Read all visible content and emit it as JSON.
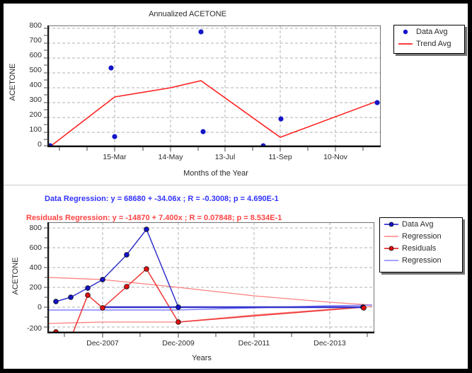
{
  "top_chart": {
    "title": "Annualized ACETONE",
    "xlabel": "Months of the Year",
    "ylabel": "ACETONE",
    "legend": [
      {
        "label": "Data Avg",
        "marker": "dot",
        "color": "#1414c8"
      },
      {
        "label": "Trend Avg",
        "marker": "line",
        "color": "#ff2222"
      }
    ],
    "yticks": [
      "0",
      "100",
      "200",
      "300",
      "400",
      "500",
      "600",
      "700",
      "800"
    ],
    "xticks": [
      "15-Mar",
      "14-May",
      "13-Jul",
      "11-Sep",
      "10-Nov"
    ]
  },
  "bottom_chart": {
    "xlabel": "Years",
    "ylabel": "ACETONE",
    "data_regression": "Data Regression: y = 68680 + -34.06x ; R = -0.3008; p = 4.690E-1",
    "residuals_regression": "Residuals Regression: y = -14870 + 7.400x ; R = 0.07848; p = 8.534E-1",
    "legend": [
      {
        "label": "Data Avg",
        "marker": "line-dot",
        "color": "#1414c8"
      },
      {
        "label": "Regression",
        "marker": "line",
        "color": "#ff8080"
      },
      {
        "label": "Residuals",
        "marker": "line-dot",
        "color": "#e01010"
      },
      {
        "label": "Regression",
        "marker": "line",
        "color": "#8080ff"
      }
    ],
    "yticks": [
      "-200",
      "0",
      "200",
      "400",
      "600",
      "800"
    ],
    "xticks": [
      "Dec-2007",
      "Dec-2009",
      "Dec-2011",
      "Dec-2013"
    ]
  },
  "colors": {
    "data_blue": "#1414c8",
    "trend_red": "#ff2222",
    "residual_red": "#e01010",
    "regression_light_red": "#ff8080",
    "regression_light_blue": "#8080ff",
    "border": "#000000",
    "grid": "#b0b0b0",
    "text": "#2b2b2b"
  },
  "chart_data": [
    {
      "type": "scatter",
      "id": "annualized-acetone",
      "title": "Annualized ACETONE",
      "xlabel": "Months of the Year",
      "ylabel": "ACETONE",
      "ylim": [
        0,
        860
      ],
      "xlim": [
        0,
        365
      ],
      "grid": true,
      "legend_position": "right-outside",
      "xtick_labels": [
        "15-Mar",
        "14-May",
        "13-Jul",
        "11-Sep",
        "10-Nov"
      ],
      "xtick_days": [
        74,
        135,
        195,
        255,
        315
      ],
      "ytick_values": [
        0,
        100,
        200,
        300,
        400,
        500,
        600,
        700,
        800
      ],
      "series": [
        {
          "name": "Data Avg",
          "type": "scatter",
          "color": "#1414c8",
          "points": [
            {
              "x": 3,
              "y": 8
            },
            {
              "x": 70,
              "y": 520
            },
            {
              "x": 74,
              "y": 72
            },
            {
              "x": 168,
              "y": 840
            },
            {
              "x": 170,
              "y": 106
            },
            {
              "x": 236,
              "y": 8
            },
            {
              "x": 256,
              "y": 188
            },
            {
              "x": 360,
              "y": 298
            }
          ]
        },
        {
          "name": "Trend Avg",
          "type": "line",
          "color": "#ff2222",
          "points": [
            {
              "x": 3,
              "y": 4
            },
            {
              "x": 74,
              "y": 330
            },
            {
              "x": 135,
              "y": 392
            },
            {
              "x": 168,
              "y": 440
            },
            {
              "x": 256,
              "y": 68
            },
            {
              "x": 360,
              "y": 300
            }
          ]
        }
      ]
    },
    {
      "type": "line",
      "id": "acetone-residuals-over-years",
      "xlabel": "Years",
      "ylabel": "ACETONE",
      "ylim": [
        -330,
        880
      ],
      "xlim": [
        2006.4,
        2015.0
      ],
      "grid": true,
      "legend_position": "right-outside",
      "xtick_labels": [
        "Dec-2007",
        "Dec-2009",
        "Dec-2011",
        "Dec-2013"
      ],
      "xtick_values": [
        2007.95,
        2009.95,
        2011.95,
        2013.95
      ],
      "ytick_values": [
        -200,
        0,
        200,
        400,
        600,
        800
      ],
      "annotations": [
        "Data Regression: y = 68680 + -34.06x ; R = -0.3008; p = 4.690E-1",
        "Residuals Regression: y = -14870 + 7.400x ; R = 0.07848; p = 8.534E-1"
      ],
      "series": [
        {
          "name": "Data Avg",
          "type": "line-marker",
          "color": "#1414c8",
          "points": [
            {
              "x": 2006.75,
              "y": 62
            },
            {
              "x": 2007.2,
              "y": 108
            },
            {
              "x": 2007.62,
              "y": 192
            },
            {
              "x": 2007.95,
              "y": 282
            },
            {
              "x": 2008.42,
              "y": 530
            },
            {
              "x": 2008.85,
              "y": 840
            },
            {
              "x": 2009.95,
              "y": 8
            },
            {
              "x": 2014.72,
              "y": 8
            }
          ]
        },
        {
          "name": "Residuals",
          "type": "line-marker",
          "color": "#e01010",
          "points": [
            {
              "x": 2006.75,
              "y": -252
            },
            {
              "x": 2007.2,
              "y": -312
            },
            {
              "x": 2007.62,
              "y": 118
            },
            {
              "x": 2007.95,
              "y": -8
            },
            {
              "x": 2008.42,
              "y": 208
            },
            {
              "x": 2008.85,
              "y": 388
            },
            {
              "x": 2009.95,
              "y": -152
            },
            {
              "x": 2014.72,
              "y": 8
            }
          ]
        },
        {
          "name": "Regression",
          "type": "line",
          "color": "#ff8080",
          "points": [
            {
              "x": 2006.55,
              "y": 302
            },
            {
              "x": 2014.85,
              "y": 22
            }
          ]
        },
        {
          "name": "Regression",
          "type": "line",
          "color": "#8080ff",
          "points": [
            {
              "x": 2006.55,
              "y": -30
            },
            {
              "x": 2014.85,
              "y": 32
            }
          ]
        },
        {
          "name": "Regression lower band",
          "type": "line",
          "color": "#ff8080",
          "points": [
            {
              "x": 2006.55,
              "y": -160
            },
            {
              "x": 2009.95,
              "y": -150
            },
            {
              "x": 2014.85,
              "y": 6
            }
          ]
        }
      ]
    }
  ]
}
